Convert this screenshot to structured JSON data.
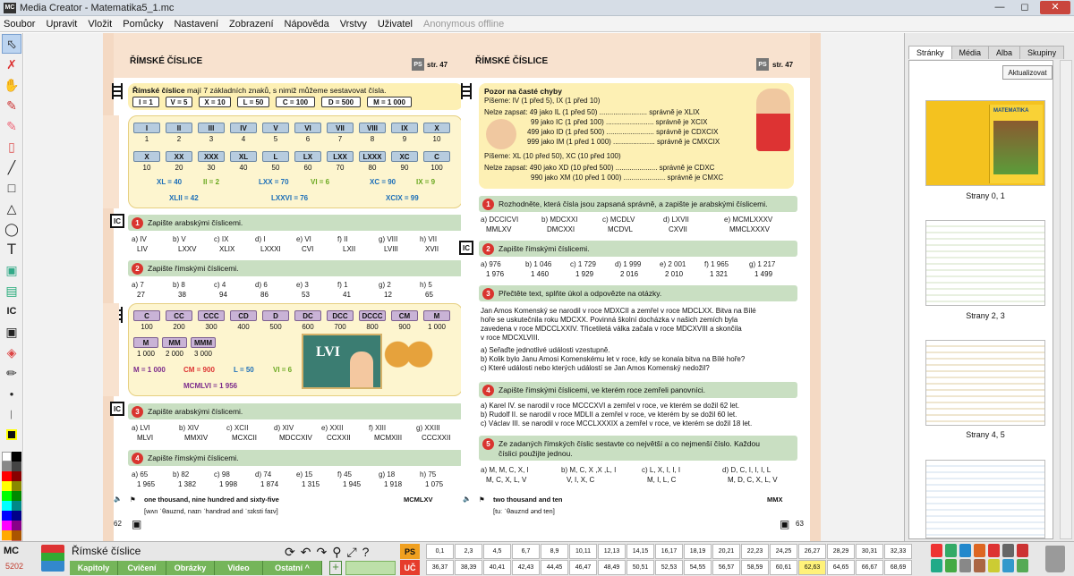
{
  "window": {
    "title": "Media Creator - Matematika5_1.mc",
    "logo": "MC"
  },
  "menu": [
    "Soubor",
    "Upravit",
    "Vložit",
    "Pomůcky",
    "Nastavení",
    "Zobrazení",
    "Nápověda",
    "Vrstvy",
    "Uživatel"
  ],
  "menu_status": "Anonymous offline",
  "left_page": {
    "title": "ŘÍMSKÉ ČÍSLICE",
    "ps": "PS",
    "str": "str. 47",
    "intro_bold": "Římské číslice",
    "intro_rest": " mají 7 základních znaků, s nimiž můžeme sestavovat čísla.",
    "base": [
      "I = 1",
      "V = 5",
      "X = 10",
      "L = 50",
      "C = 100",
      "D = 500",
      "M = 1 000"
    ],
    "units_roman": [
      "I",
      "II",
      "III",
      "IV",
      "V",
      "VI",
      "VII",
      "VIII",
      "IX",
      "X"
    ],
    "units_val": [
      "1",
      "2",
      "3",
      "4",
      "5",
      "6",
      "7",
      "8",
      "9",
      "10"
    ],
    "tens_roman": [
      "X",
      "XX",
      "XXX",
      "XL",
      "L",
      "LX",
      "LXX",
      "LXXX",
      "XC",
      "C"
    ],
    "tens_val": [
      "10",
      "20",
      "30",
      "40",
      "50",
      "60",
      "70",
      "80",
      "90",
      "100"
    ],
    "ex1": [
      "XL = 40",
      "II = 2",
      "LXX = 70",
      "VI = 6",
      "XC = 90",
      "IX = 9"
    ],
    "ex1b": [
      "XLII = 42",
      "LXXVI = 76",
      "XCIX = 99"
    ],
    "task1": {
      "n": "1",
      "text": "Zapište arabskými číslicemi."
    },
    "task1_items": [
      [
        "a) IV",
        "LIV"
      ],
      [
        "b) V",
        "LXXV"
      ],
      [
        "c) IX",
        "XLIX"
      ],
      [
        "d) I",
        "LXXXI"
      ],
      [
        "e) VI",
        "CVI"
      ],
      [
        "f) II",
        "LXII"
      ],
      [
        "g) VIII",
        "LVIII"
      ],
      [
        "h) VII",
        "XVII"
      ]
    ],
    "task2": {
      "n": "2",
      "text": "Zapište římskými číslicemi."
    },
    "task2_items": [
      [
        "a) 7",
        "27"
      ],
      [
        "b) 8",
        "38"
      ],
      [
        "c) 4",
        "94"
      ],
      [
        "d) 6",
        "86"
      ],
      [
        "e) 3",
        "53"
      ],
      [
        "f) 1",
        "41"
      ],
      [
        "g) 2",
        "12"
      ],
      [
        "h) 5",
        "65"
      ]
    ],
    "hund_roman": [
      "C",
      "CC",
      "CCC",
      "CD",
      "D",
      "DC",
      "DCC",
      "DCCC",
      "CM",
      "M"
    ],
    "hund_val": [
      "100",
      "200",
      "300",
      "400",
      "500",
      "600",
      "700",
      "800",
      "900",
      "1 000"
    ],
    "thou_roman": [
      "M",
      "MM",
      "MMM"
    ],
    "thou_val": [
      "1 000",
      "2 000",
      "3 000"
    ],
    "ex2": [
      "M = 1 000",
      "CM = 900",
      "L = 50",
      "VI = 6"
    ],
    "ex2b": "MCMLVI = 1 956",
    "board": "LVI",
    "task3": {
      "n": "3",
      "text": "Zapište arabskými číslicemi."
    },
    "task3_items": [
      [
        "a) LVI",
        "MLVI"
      ],
      [
        "b) XIV",
        "MMXIV"
      ],
      [
        "c) XCII",
        "MCXCII"
      ],
      [
        "d) XIV",
        "MDCCXIV"
      ],
      [
        "e) XXII",
        "CCXXII"
      ],
      [
        "f) XIII",
        "MCMXIII"
      ],
      [
        "g) XXIII",
        "CCCXXII"
      ]
    ],
    "task4": {
      "n": "4",
      "text": "Zapište římskými číslicemi."
    },
    "task4_items": [
      [
        "a) 65",
        "1 965"
      ],
      [
        "b) 82",
        "1 382"
      ],
      [
        "c) 98",
        "1 998"
      ],
      [
        "d) 74",
        "1 874"
      ],
      [
        "e) 15",
        "1 315"
      ],
      [
        "f) 45",
        "1 945"
      ],
      [
        "g) 18",
        "1 918"
      ],
      [
        "h) 75",
        "1 075"
      ]
    ],
    "foot_en": "one thousand, nine hundred and sixty-five",
    "foot_ipa": "[wʌn ˈθauznd, naɪn ˈhandrəd and ˈsɪksti faɪv]",
    "foot_roman": "MCMLXV",
    "page_no": "62"
  },
  "right_page": {
    "title": "ŘÍMSKÉ ČÍSLICE",
    "ps": "PS",
    "str": "str. 47",
    "warn_title": "Pozor na časté chyby",
    "warn_l1": "Píšeme: IV (1 před 5), IX (1 před 10)",
    "warn_l2": "Nelze zapsat: 49 jako IL (1 před 50) ........................ správně je XLIX",
    "warn_l3": "99 jako IC (1 před 100) ........................ správně je XCIX",
    "warn_l4": "499 jako ID (1 před 500) ........................ správně je CDXCIX",
    "warn_l5": "999 jako IM (1 před 1 000) ..................... správně je CMXCIX",
    "warn_l6": "Píšeme: XL (10 před 50), XC (10 před 100)",
    "warn_l7": "Nelze zapsat: 490 jako XD (10 před 500) ..................... správně je CDXC",
    "warn_l8": "990 jako XM (10 před 1 000) ..................... správně je CMXC",
    "task1": {
      "n": "1",
      "text": "Rozhodněte, která čísla jsou zapsaná správně, a zapište je arabskými číslicemi."
    },
    "task1_items": [
      [
        "a) DCCICVI",
        "MMLXV"
      ],
      [
        "b) MDCXXI",
        "DMCXXI"
      ],
      [
        "c) MCDLV",
        "MCDVL"
      ],
      [
        "d) LXVII",
        "CXVII"
      ],
      [
        "e) MCMLXXXV",
        "MMCLXXXV"
      ]
    ],
    "task2": {
      "n": "2",
      "text": "Zapište římskými číslicemi."
    },
    "task2_items": [
      [
        "a) 976",
        "1 976"
      ],
      [
        "b) 1 046",
        "1 460"
      ],
      [
        "c) 1 729",
        "1 929"
      ],
      [
        "d) 1 999",
        "2 016"
      ],
      [
        "e) 2 001",
        "2 010"
      ],
      [
        "f) 1 965",
        "1 321"
      ],
      [
        "g) 1 217",
        "1 499"
      ]
    ],
    "task3": {
      "n": "3",
      "text": "Přečtěte text, splňte úkol a odpovězte na otázky."
    },
    "task3_text": [
      "Jan Amos Komenský se narodil v roce MDXCII a zemřel v roce MDCLXX. Bitva na Bílé",
      "hoře se uskutečnila roku MDCXX. Povinná školní docházka v našich zemích byla",
      "zavedena v roce MDCCLXXIV. Třicetiletá válka začala v roce MDCXVIII a skončila",
      "v roce MDCXLVIII."
    ],
    "task3_q": [
      "a) Seřaďte jednotlivé události vzestupně.",
      "b) Kolik bylo Janu Amosi Komenskému let v roce, kdy se konala bitva na Bílé hoře?",
      "c) Které události nebo kterých událostí se Jan Amos Komenský nedožil?"
    ],
    "task4": {
      "n": "4",
      "text": "Zapište římskými číslicemi, ve kterém roce zemřeli panovníci."
    },
    "task4_lines": [
      "a) Karel IV. se narodil v roce MCCCXVI a zemřel v roce, ve kterém se dožil 62 let.",
      "b) Rudolf II. se narodil v roce MDLII a zemřel v roce, ve kterém by se dožil 60 let.",
      "c) Václav III. se narodil v roce MCCLXXXIX a zemřel v roce, ve kterém se dožil 18 let."
    ],
    "task5": {
      "n": "5",
      "text1": "Ze zadaných římských číslic sestavte co největší a co nejmenší číslo. Každou",
      "text2": "číslici použijte jednou."
    },
    "task5_items": [
      [
        "a) M, M, C, X, I",
        "M, C, X, L, V"
      ],
      [
        "b) M, C, X ,X ,L, I",
        "V, I, X, C"
      ],
      [
        "c) L, X, I, I, I",
        "M, I, L, C"
      ],
      [
        "d) D, C, I, I, I, L",
        "M, D, C, X, L, V"
      ]
    ],
    "foot_en": "two thousand and ten",
    "foot_ipa": "[tuː ˈθauznd ənd ten]",
    "foot_roman": "MMX",
    "page_no": "63"
  },
  "panel": {
    "tabs": [
      "Stránky",
      "Média",
      "Alba",
      "Skupiny"
    ],
    "update": "Aktualizovat",
    "thumbs": [
      "Strany 0, 1",
      "Strany 2, 3",
      "Strany 4, 5"
    ],
    "cover_title": "MATEMATIKA"
  },
  "bottom": {
    "mc": "MC",
    "mc_id": "5202",
    "chapter": "Římské číslice",
    "nav": [
      "Kapitoly",
      "Cvičení",
      "Obrázky",
      "Video",
      "Ostatní ^"
    ],
    "ps": "PS",
    "uc": "UČ",
    "pages_top": [
      "0,1",
      "2,3",
      "4,5",
      "6,7",
      "8,9",
      "10,11",
      "12,13",
      "14,15",
      "16,17",
      "18,19",
      "20,21",
      "22,23",
      "24,25",
      "26,27",
      "28,29",
      "30,31",
      "32,33"
    ],
    "pages_bottom": [
      "36,37",
      "38,39",
      "40,41",
      "42,43",
      "44,45",
      "46,47",
      "48,49",
      "50,51",
      "52,53",
      "54,55",
      "56,57",
      "58,59",
      "60,61",
      "62,63",
      "64,65",
      "66,67",
      "68,69"
    ],
    "highlight": "62,63"
  },
  "colors": {
    "accent_red": "#d9352f",
    "task_green": "#c9dfc2",
    "note_yellow": "#fdf0b4",
    "page_peach": "#f8e2cf"
  }
}
